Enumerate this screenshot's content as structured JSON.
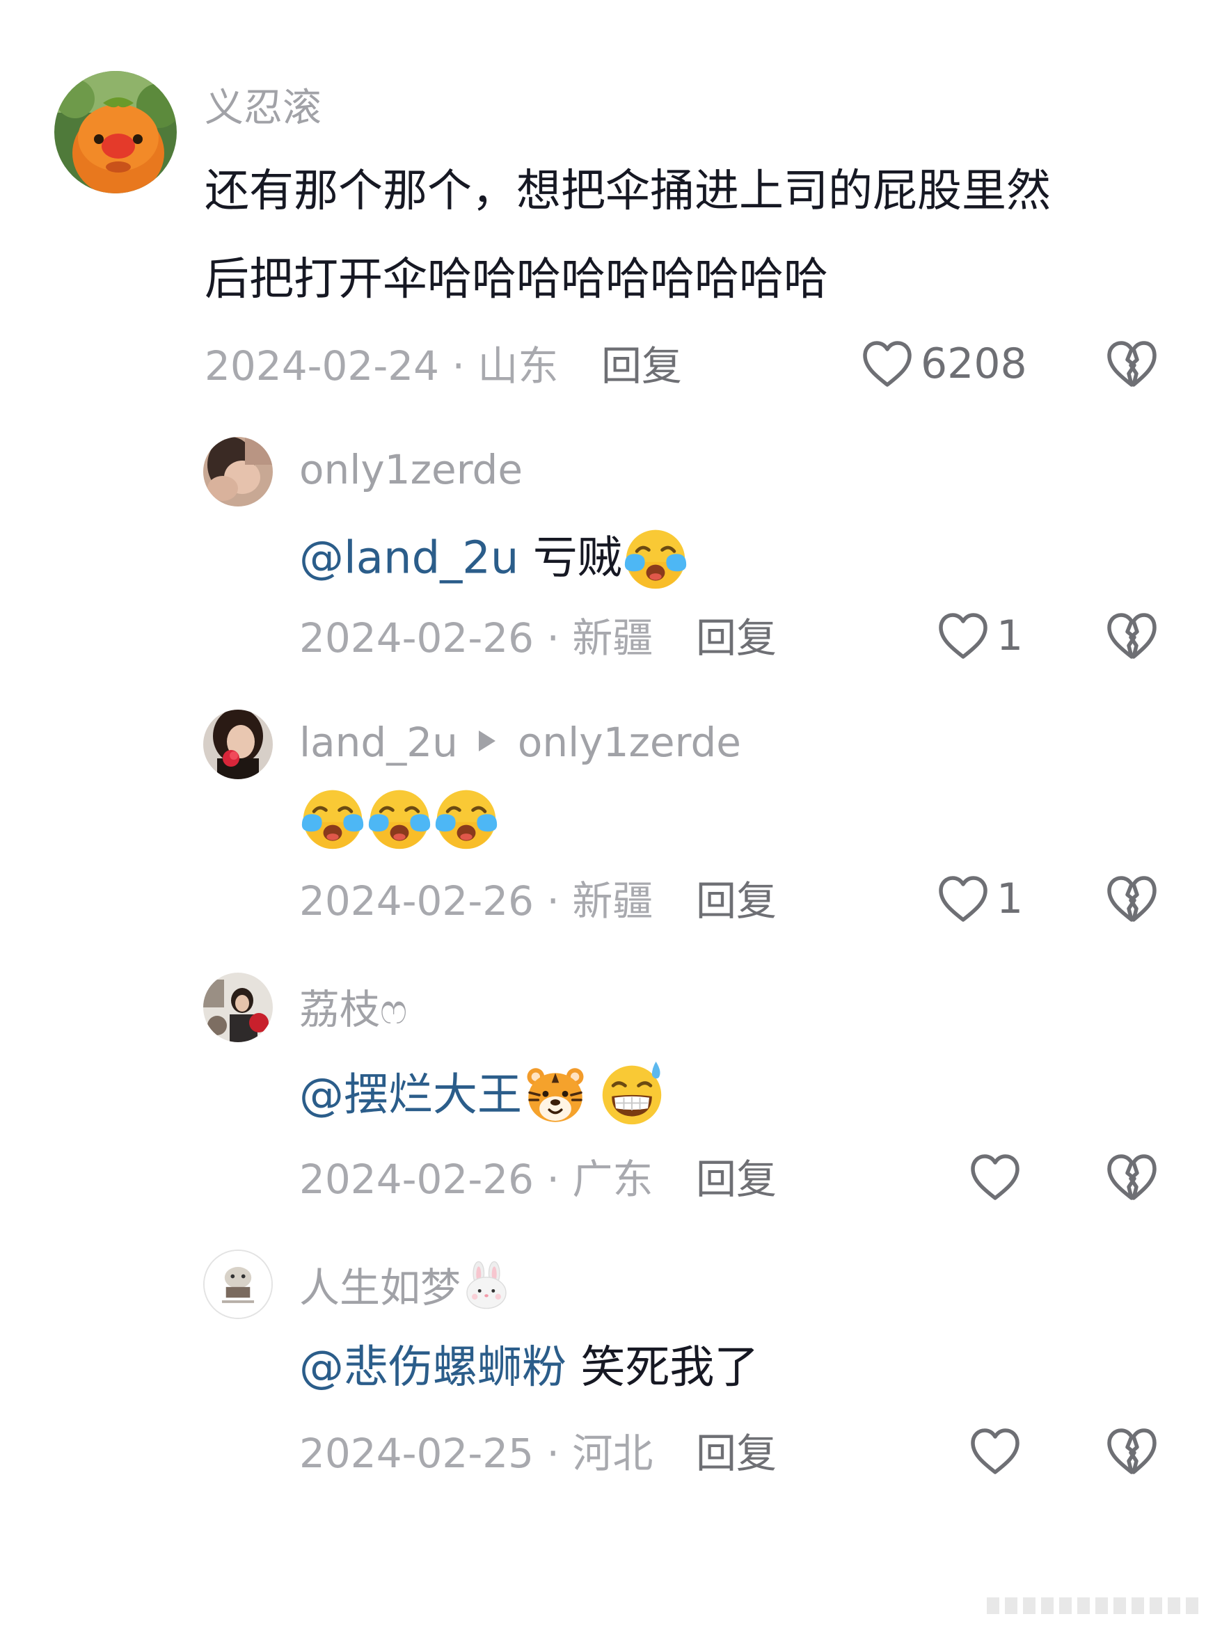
{
  "main_comment": {
    "username": "义忍滚",
    "text_line1": "还有那个那个，想把伞捅进上司的屁股里然",
    "text_line2": "后把打开伞哈哈哈哈哈哈哈哈哈",
    "date": "2024-02-24",
    "location": "山东",
    "reply_label": "回复",
    "likes": "6208"
  },
  "replies": [
    {
      "username": "only1zerde",
      "mention": "@land_2u",
      "text": " 亏贼",
      "emojis": [
        "loudly-crying-face"
      ],
      "date": "2024-02-26",
      "location": "新疆",
      "reply_label": "回复",
      "likes": "1"
    },
    {
      "username": "land_2u",
      "reply_to": "only1zerde",
      "emojis": [
        "loudly-crying-face",
        "loudly-crying-face",
        "loudly-crying-face"
      ],
      "date": "2024-02-26",
      "location": "新疆",
      "reply_label": "回复",
      "likes": "1"
    },
    {
      "username": "荔枝ෆ",
      "mention": "@摆烂大王",
      "emojis": [
        "tiger-face",
        "grinning-sweat-face"
      ],
      "date": "2024-02-26",
      "location": "广东",
      "reply_label": "回复",
      "likes": ""
    },
    {
      "username": "人生如梦",
      "username_emoji": "rabbit-face",
      "mention": "@悲伤螺蛳粉",
      "text": " 笑死我了",
      "date": "2024-02-25",
      "location": "河北",
      "reply_label": "回复",
      "likes": ""
    }
  ],
  "colors": {
    "username": "#a1a2a7",
    "text": "#161823",
    "mention": "#2b5d8a",
    "meta": "#a8a9ae",
    "action": "#6e6f74"
  }
}
